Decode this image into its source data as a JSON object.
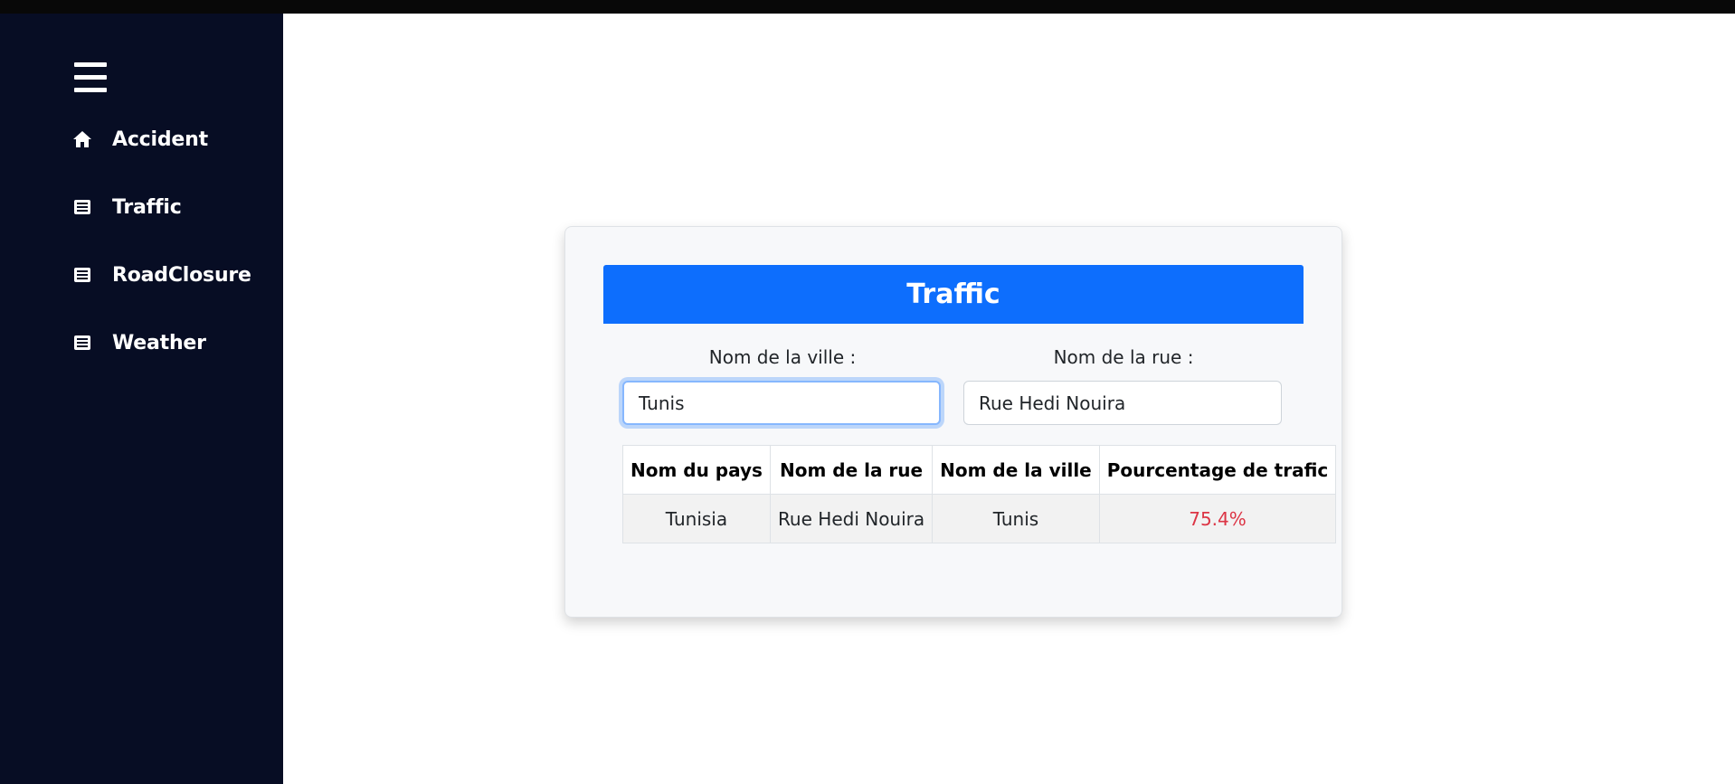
{
  "sidebar": {
    "menu_icon": "hamburger-menu-icon",
    "items": [
      {
        "label": "Accident",
        "icon": "home-icon"
      },
      {
        "label": "Traffic",
        "icon": "newspaper-icon"
      },
      {
        "label": "RoadClosure",
        "icon": "newspaper-icon"
      },
      {
        "label": "Weather",
        "icon": "newspaper-icon"
      }
    ]
  },
  "card": {
    "title": "Traffic",
    "city_label": "Nom de la ville :",
    "city_value": "Tunis",
    "street_label": "Nom de la rue :",
    "street_value": "Rue Hedi Nouira"
  },
  "table": {
    "headers": [
      "Nom du pays",
      "Nom de la rue",
      "Nom de la ville",
      "Pourcentage de trafic"
    ],
    "rows": [
      [
        "Tunisia",
        "Rue Hedi Nouira",
        "Tunis",
        "75.4%"
      ]
    ]
  },
  "colors": {
    "sidebar_bg": "#070d24",
    "header_blue": "#0d6efd",
    "percentage_red": "#dc3545"
  }
}
